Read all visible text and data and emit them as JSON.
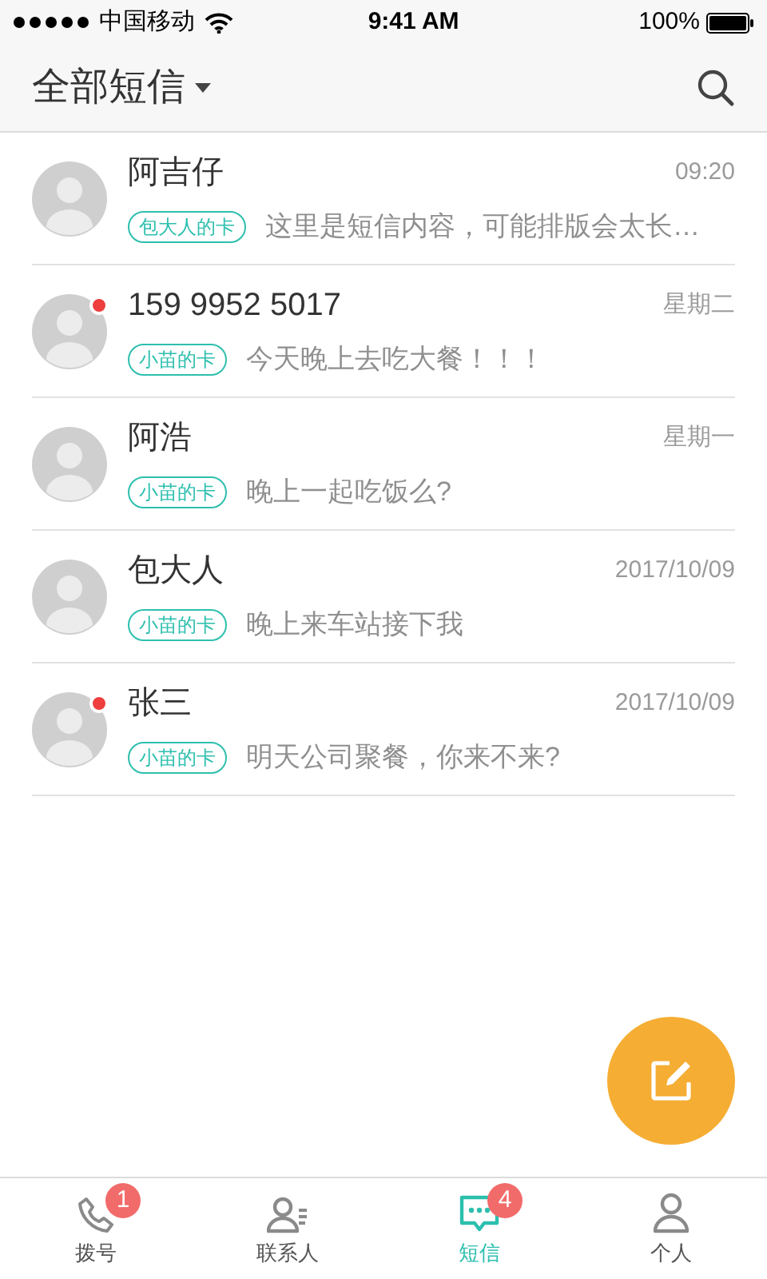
{
  "status_bar": {
    "carrier": "中国移动",
    "time": "9:41 AM",
    "battery": "100%"
  },
  "header": {
    "title": "全部短信"
  },
  "messages": [
    {
      "name": "阿吉仔",
      "time": "09:20",
      "card": "包大人的卡",
      "preview": "这里是短信内容，可能排版会太长…",
      "unread": false
    },
    {
      "name": "159 9952 5017",
      "time": "星期二",
      "card": "小苗的卡",
      "preview": "今天晚上去吃大餐！！！",
      "unread": true
    },
    {
      "name": "阿浩",
      "time": "星期一",
      "card": "小苗的卡",
      "preview": "晚上一起吃饭么?",
      "unread": false
    },
    {
      "name": "包大人",
      "time": "2017/10/09",
      "card": "小苗的卡",
      "preview": "晚上来车站接下我",
      "unread": false
    },
    {
      "name": "张三",
      "time": "2017/10/09",
      "card": "小苗的卡",
      "preview": "明天公司聚餐，你来不来?",
      "unread": true
    }
  ],
  "tabs": [
    {
      "kind": "phone",
      "label": "拨号",
      "badge": "1",
      "selected": false
    },
    {
      "kind": "contacts",
      "label": "联系人",
      "selected": false
    },
    {
      "kind": "sms",
      "label": "短信",
      "badge": "4",
      "selected": true
    },
    {
      "kind": "profile",
      "label": "个人",
      "selected": false
    }
  ]
}
